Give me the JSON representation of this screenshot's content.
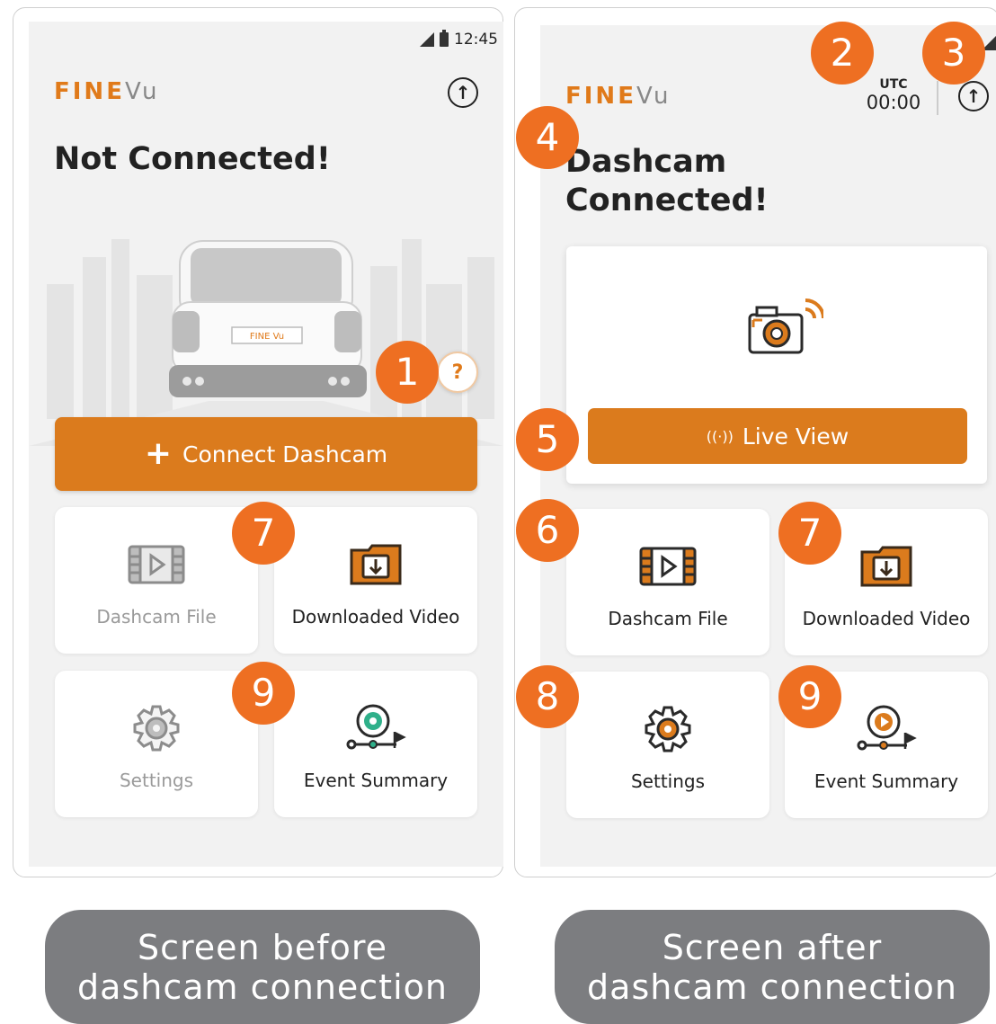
{
  "left": {
    "status_time": "12:45",
    "logo_fine": "FINE",
    "logo_vu": "Vu",
    "headline": "Not Connected!",
    "plate_text": "FINE Vu",
    "help_label": "?",
    "connect_label": "Connect Dashcam",
    "tiles": [
      {
        "label": "Dashcam File",
        "enabled": false
      },
      {
        "label": "Downloaded Video",
        "enabled": true
      },
      {
        "label": "Settings",
        "enabled": false
      },
      {
        "label": "Event Summary",
        "enabled": true
      }
    ],
    "badges": [
      "1",
      "7",
      "9"
    ]
  },
  "right": {
    "logo_fine": "FINE",
    "logo_vu": "Vu",
    "utc_label": "UTC",
    "utc_time": "00:00",
    "headline_line1": "Dashcam",
    "headline_line2": "Connected!",
    "live_label": "Live View",
    "live_icon_text": "((·))",
    "tiles": [
      {
        "label": "Dashcam File"
      },
      {
        "label": "Downloaded Video"
      },
      {
        "label": "Settings"
      },
      {
        "label": "Event Summary"
      }
    ],
    "badges": [
      "2",
      "3",
      "4",
      "5",
      "6",
      "7",
      "8",
      "9"
    ]
  },
  "captions": {
    "left_line1": "Screen before",
    "left_line2": "dashcam connection",
    "right_line1": "Screen after",
    "right_line2": "dashcam connection"
  },
  "colors": {
    "accent": "#db7b1d",
    "badge": "#ee6f22",
    "screen_bg": "#f2f2f2",
    "caption_bg": "#7c7d80"
  }
}
